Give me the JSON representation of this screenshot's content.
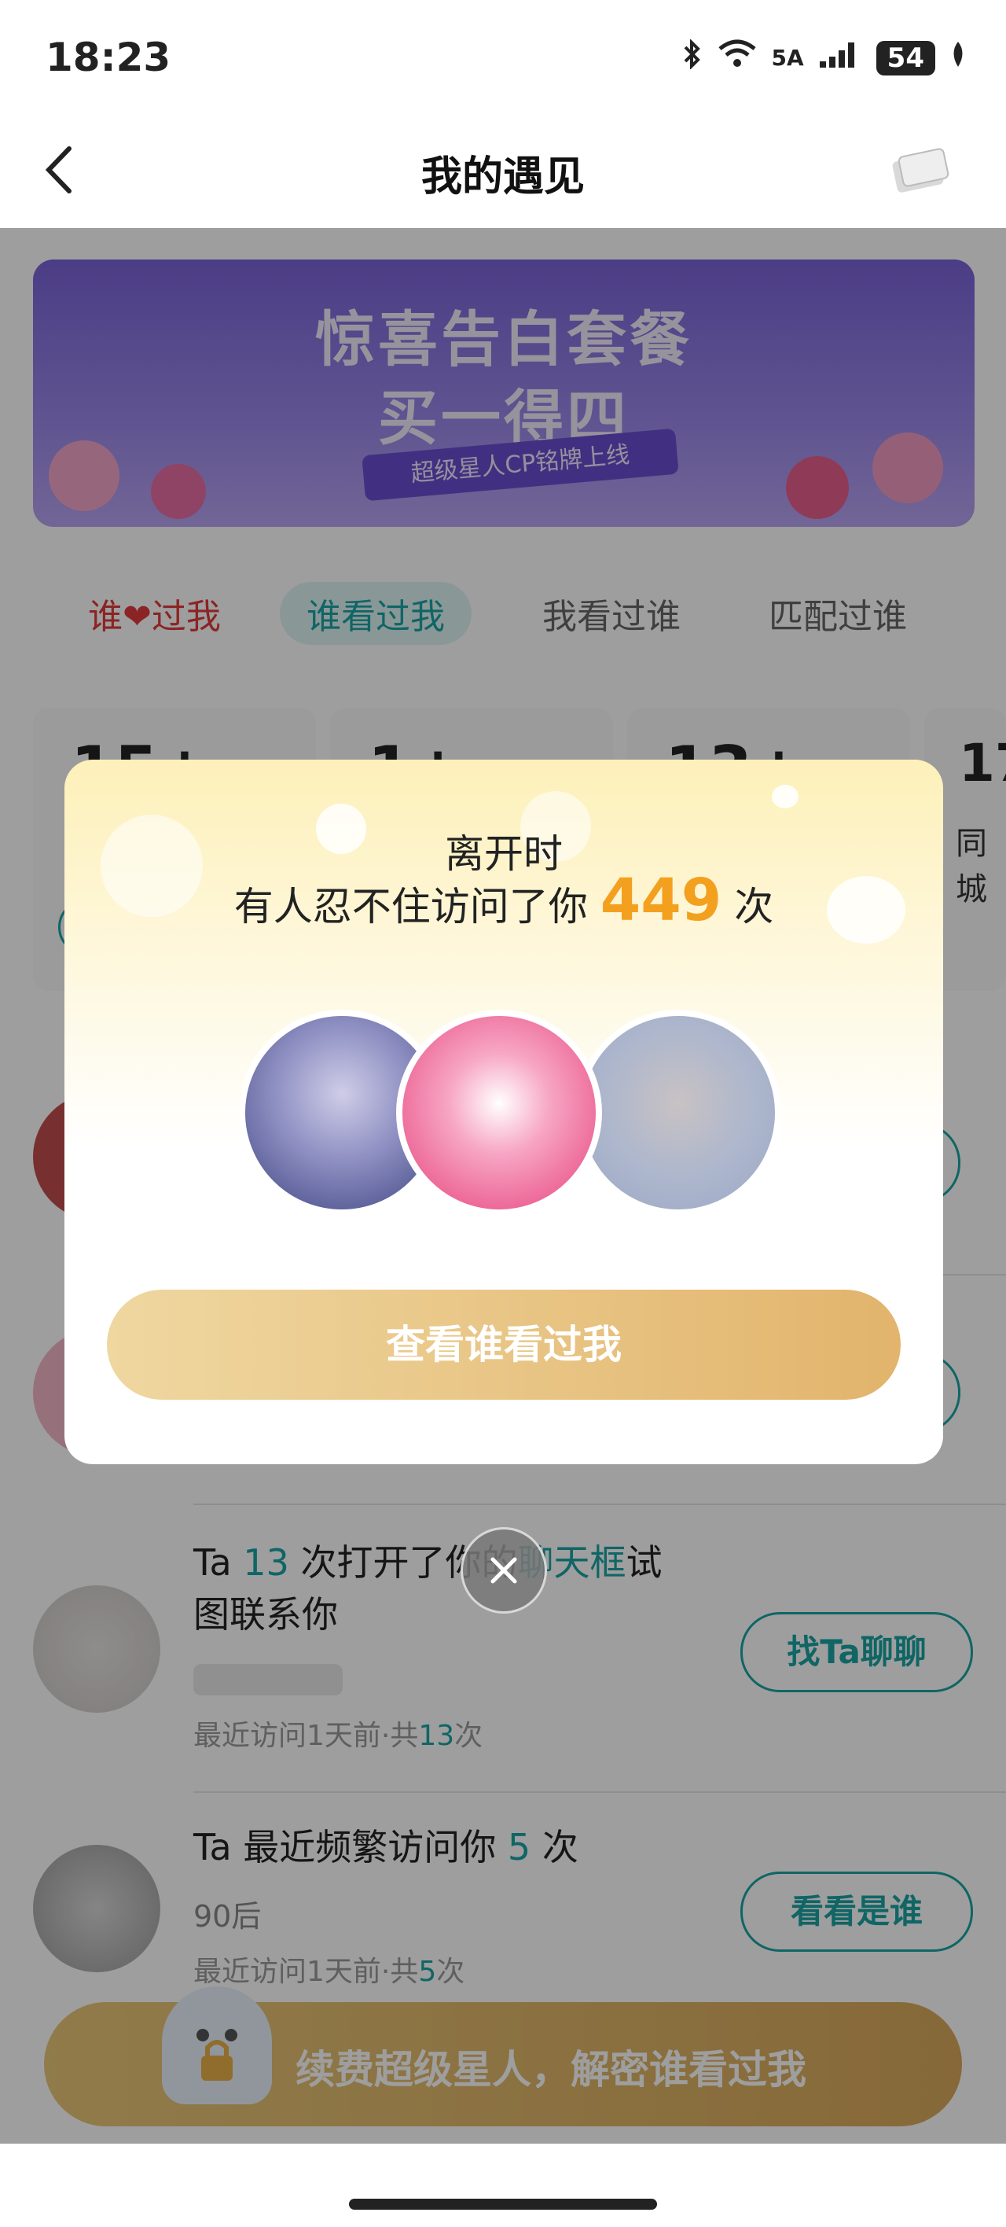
{
  "status_bar": {
    "time": "18:23",
    "network": "5A",
    "battery": "54"
  },
  "header": {
    "title": "我的遇见",
    "back_icon": "chevron-left-icon",
    "card_icon": "card-gift-icon"
  },
  "banner": {
    "line1": "惊喜告白套餐",
    "line2": "买一得四",
    "ribbon": "超级星人CP铭牌上线"
  },
  "tabs": [
    {
      "label_prefix": "谁",
      "label_suffix": "过我"
    },
    {
      "label": "谁看过我"
    },
    {
      "label": "我看过谁"
    },
    {
      "label": "匹配过谁"
    }
  ],
  "stats": [
    {
      "num": "15+",
      "label": ""
    },
    {
      "num": "1+",
      "label": ""
    },
    {
      "num": "13+",
      "label": ""
    },
    {
      "num": "17",
      "label": "同城"
    }
  ],
  "list": [
    {
      "title_a": "Ta ",
      "title_num": "13",
      "title_b": " 次打开了你的",
      "title_hl": "聊天框",
      "title_c": "试",
      "title_d": "图联系你",
      "meta_a": "最近访问1天前·共",
      "meta_num": "13",
      "meta_b": "次",
      "button": "找Ta聊聊"
    },
    {
      "title_a": "Ta 最近频繁访问你 ",
      "title_num": "5",
      "title_b": " 次",
      "sub": "90后",
      "meta_a": "最近访问1天前·共",
      "meta_num": "5",
      "meta_b": "次",
      "button": "看看是谁"
    }
  ],
  "bottom_cta": {
    "label": "续费超级星人，解密谁看过我"
  },
  "modal": {
    "line1": "离开时",
    "line2_a": "有人忍不住访问了你",
    "count": "449",
    "line2_b": "次",
    "button": "查看谁看过我",
    "close_icon": "close-icon"
  },
  "colors": {
    "accent": "#1aa3a3",
    "gold": "#e2b46c",
    "count": "#f3a01e",
    "love": "#e03a3a"
  }
}
